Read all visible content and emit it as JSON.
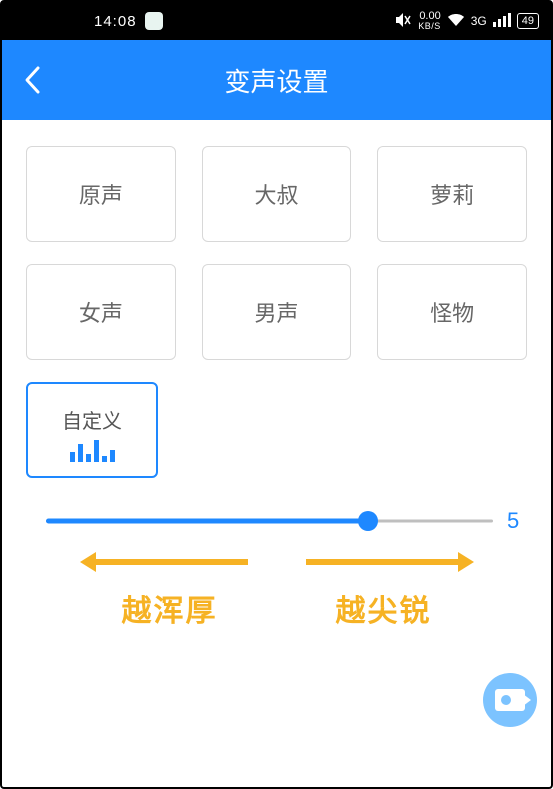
{
  "statusbar": {
    "time": "14:08",
    "net_speed_value": "0.00",
    "net_speed_unit": "KB/S",
    "network_label": "3G",
    "battery": "49"
  },
  "header": {
    "title": "变声设置"
  },
  "tiles": [
    {
      "label": "原声"
    },
    {
      "label": "大叔"
    },
    {
      "label": "萝莉"
    },
    {
      "label": "女声"
    },
    {
      "label": "男声"
    },
    {
      "label": "怪物"
    }
  ],
  "custom_tile": {
    "label": "自定义"
  },
  "slider": {
    "value": 5,
    "min": 0,
    "max": 7,
    "fill_percent": 72
  },
  "hints": {
    "left": "越浑厚",
    "right": "越尖锐"
  },
  "colors": {
    "primary": "#1e88ff",
    "accent": "#f6b224"
  }
}
